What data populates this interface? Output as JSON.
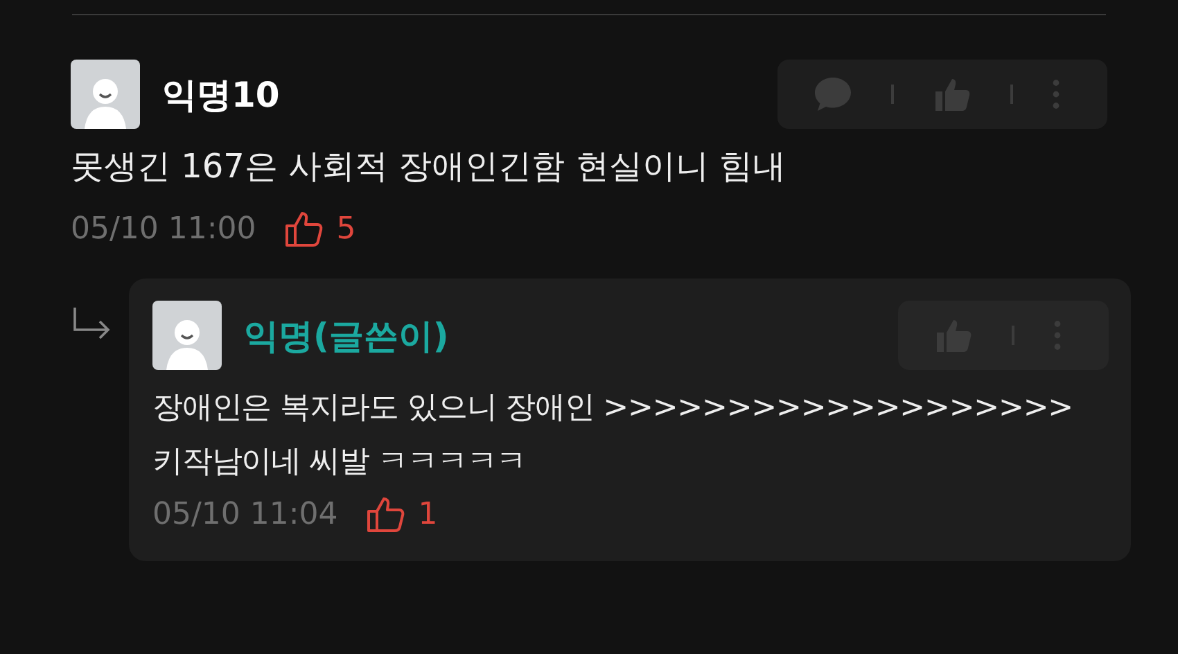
{
  "comment": {
    "author": "익명10",
    "is_writer": false,
    "actions": [
      {
        "kind": "comment"
      },
      {
        "kind": "like"
      },
      {
        "kind": "more"
      }
    ],
    "body": "못생긴 167은 사회적 장애인긴함 현실이니 힘내",
    "time": "05/10 11:00",
    "likes": "5",
    "replies": [
      {
        "author": "익명(글쓴이)",
        "is_writer": true,
        "actions": [
          {
            "kind": "like"
          },
          {
            "kind": "more"
          }
        ],
        "body": "장애인은 복지라도 있으니 장애인 >>>>>>>>>>>>>>>>>>> 키작남이네 씨발 ㅋㅋㅋㅋㅋ",
        "time": "05/10 11:04",
        "likes": "1"
      }
    ]
  }
}
